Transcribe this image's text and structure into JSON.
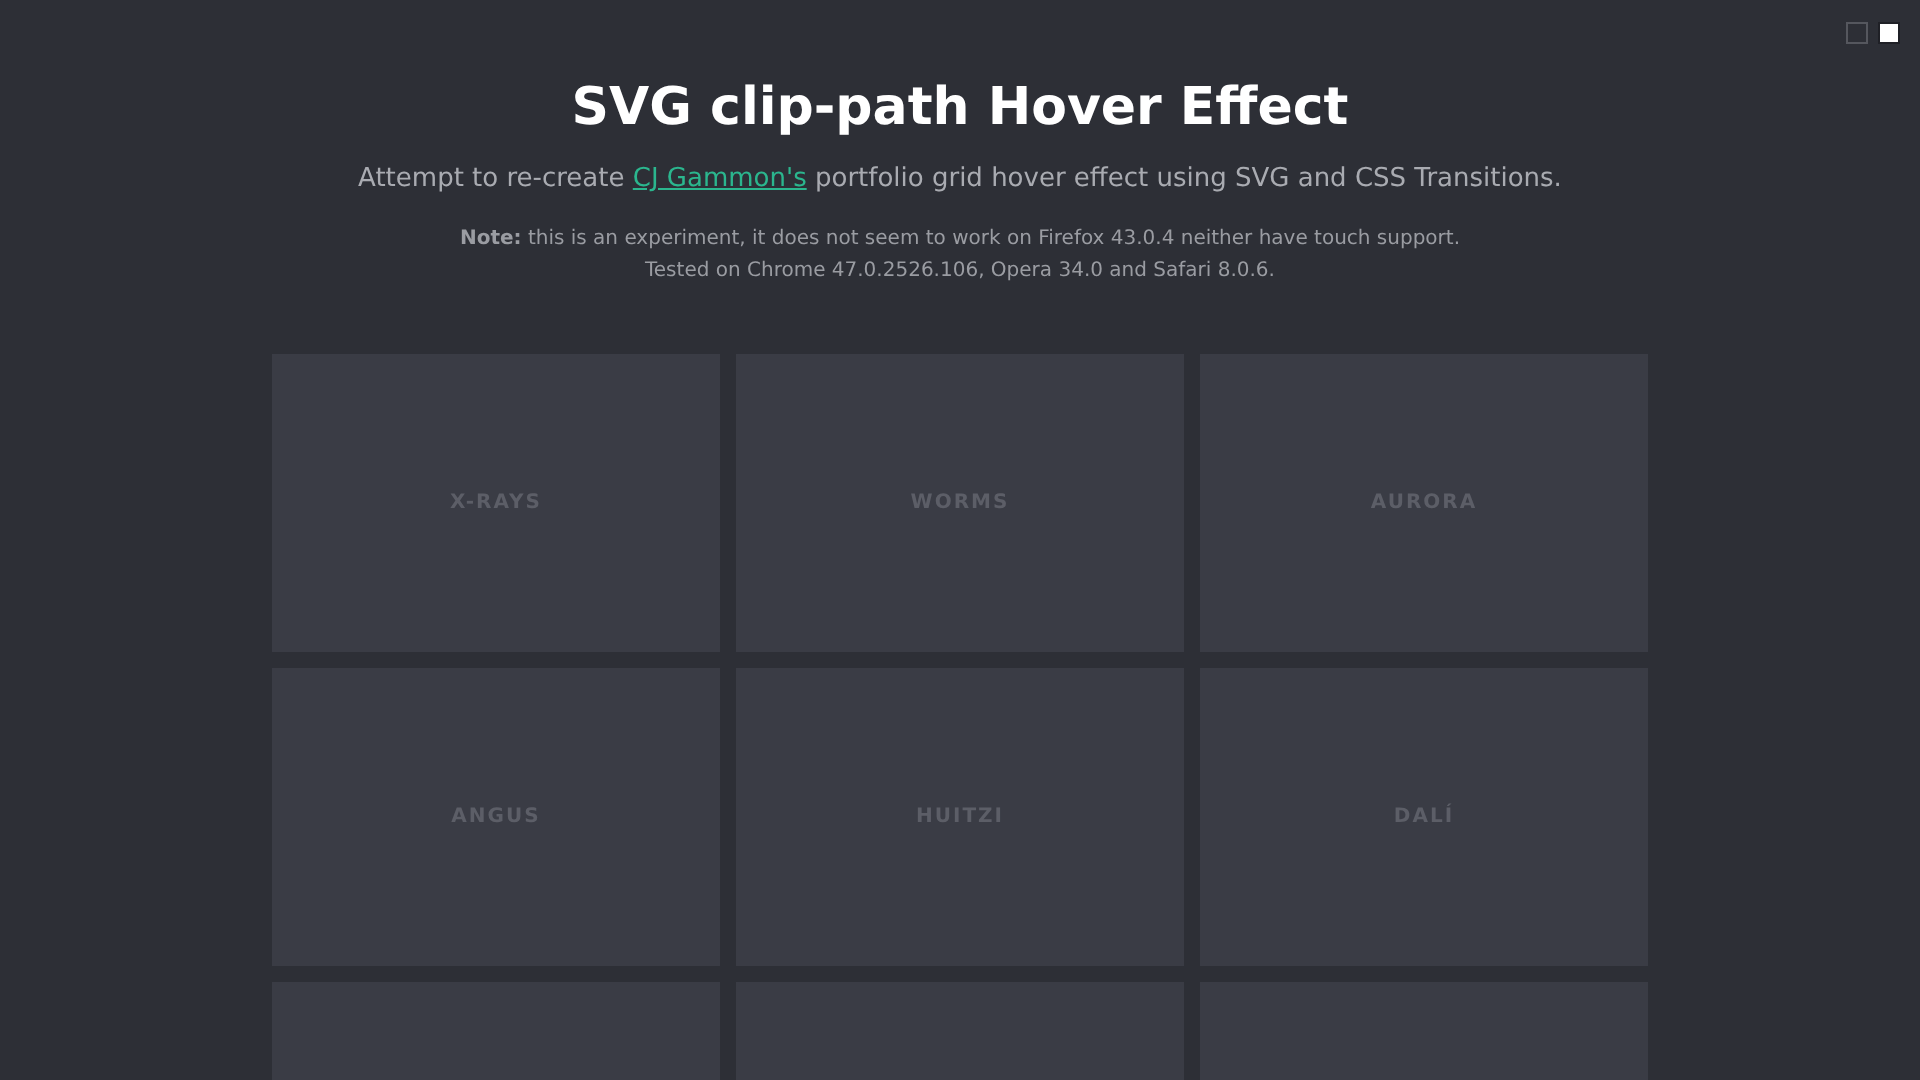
{
  "theme_swatches": [
    {
      "kind": "dark",
      "selected": false
    },
    {
      "kind": "light",
      "selected": true
    }
  ],
  "title": "SVG clip-path Hover Effect",
  "intro": {
    "before": "Attempt to re-create",
    "link": "CJ Gammon's",
    "after": "portfolio grid hover effect using SVG and CSS Transitions."
  },
  "note": [
    "**Note:** this is an experiment, it does not seem to work on Firefox 43.0.4 neither have touch support.",
    "Tested on Chrome 47.0.2526.106, Opera 34.0 and Safari 8.0.6."
  ],
  "tiles": [
    {
      "kind": "labeled",
      "label": "X-RAYS"
    },
    {
      "kind": "labeled",
      "label": "WORMS"
    },
    {
      "kind": "labeled",
      "label": "AURORA"
    },
    {
      "kind": "labeled",
      "label": "ANGUS"
    },
    {
      "kind": "labeled",
      "label": "HUITZI"
    },
    {
      "kind": "labeled",
      "label": "DALÍ"
    },
    {
      "kind": "blank"
    },
    {
      "kind": "blank"
    },
    {
      "kind": "blank"
    }
  ]
}
